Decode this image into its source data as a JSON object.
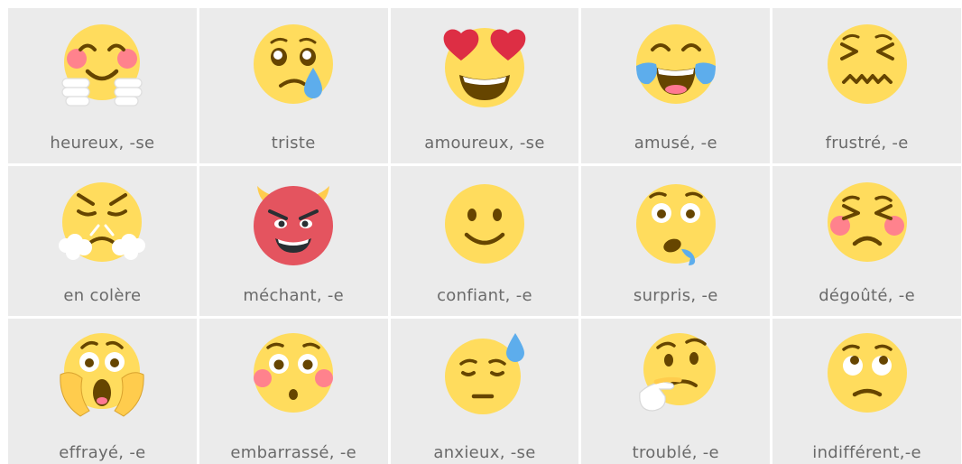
{
  "colors": {
    "tile_background": "#ebebeb",
    "face_yellow": "#ffdc5d",
    "feature_brown": "#664500",
    "blush_pink": "#ff7892",
    "heart_red": "#dd2e44",
    "tear_blue": "#5dadec",
    "devil_red": "#e4545f",
    "label_gray": "#6a6a6a"
  },
  "emotions": [
    {
      "label": "heureux, -se",
      "icon": "hugging-face-icon"
    },
    {
      "label": "triste",
      "icon": "crying-face-icon"
    },
    {
      "label": "amoureux, -se",
      "icon": "heart-eyes-face-icon"
    },
    {
      "label": "amusé, -e",
      "icon": "tears-of-joy-face-icon"
    },
    {
      "label": "frustré, -e",
      "icon": "confounded-face-icon"
    },
    {
      "label": "en colère",
      "icon": "steam-from-nose-face-icon"
    },
    {
      "label": "méchant, -e",
      "icon": "smiling-devil-face-icon"
    },
    {
      "label": "confiant, -e",
      "icon": "slightly-smiling-face-icon"
    },
    {
      "label": "surpris, -e",
      "icon": "drooling-face-icon"
    },
    {
      "label": "dégoûté, -e",
      "icon": "persevering-face-icon"
    },
    {
      "label": "effrayé, -e",
      "icon": "screaming-in-fear-face-icon"
    },
    {
      "label": "embarrassé, -e",
      "icon": "flushed-face-icon"
    },
    {
      "label": "anxieux, -se",
      "icon": "downcast-sweat-face-icon"
    },
    {
      "label": "troublé, -e",
      "icon": "thinking-face-icon"
    },
    {
      "label": "indifférent,-e",
      "icon": "eye-roll-face-icon"
    }
  ]
}
